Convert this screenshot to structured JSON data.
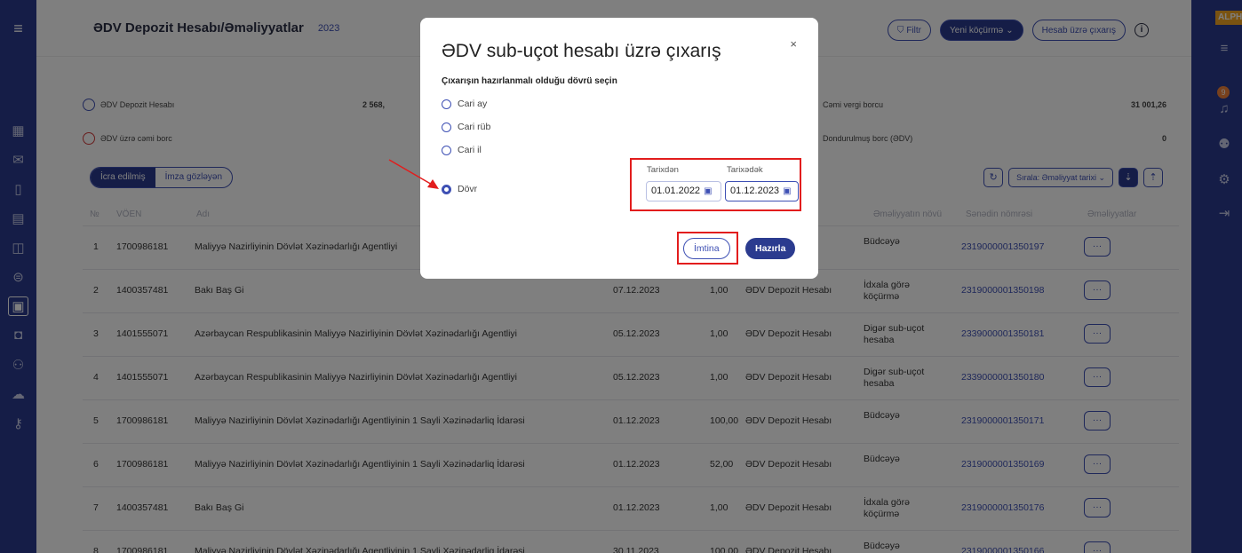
{
  "header": {
    "title": "ƏDV Depozit Hesabı/Əməliyyatlar",
    "year": "2023",
    "filter_label": "Filtr",
    "new_transfer_label": "Yeni köçürmə",
    "statement_label": "Hesab üzrə çıxarış",
    "info_symbol": "i"
  },
  "right_panel": {
    "alpha_label": "ALPH",
    "notification_count": "9"
  },
  "summary": {
    "left_row1_label": "ƏDV Depozit Hesabı",
    "left_row1_value": "2 568,",
    "left_row2_label": "ƏDV üzrə cəmi borc",
    "right_row1_label": "Cəmi vergi borcu",
    "right_row1_value": "31 001,26",
    "right_row2_label": "Dondurulmuş borc (ƏDV)",
    "right_row2_value": "0"
  },
  "tabs": {
    "executed": "İcra edilmiş",
    "awaiting_signature": "İmza gözləyən"
  },
  "sort": {
    "label": "Sırala: Əməliyyat tarixi"
  },
  "table": {
    "columns": {
      "no": "№",
      "voen": "VÖEN",
      "name": "Adı",
      "type": "Əməliyyatın növü",
      "doc": "Sənədin nömrəsi",
      "actions": "Əməliyyatlar"
    },
    "rows": [
      {
        "no": "1",
        "voen": "1700986181",
        "name": "Maliyyə Nazirliyinin Dövlət Xəzinədarlığı Agentliyi",
        "date": "",
        "amount": "",
        "account": "Hesabı",
        "type": "Büdcəyə",
        "doc": "2319000001350197"
      },
      {
        "no": "2",
        "voen": "1400357481",
        "name": "Bakı Baş Gi",
        "date": "07.12.2023",
        "amount": "1,00",
        "account": "ƏDV Depozit Hesabı",
        "type": "İdxala görə köçürmə",
        "doc": "2319000001350198"
      },
      {
        "no": "3",
        "voen": "1401555071",
        "name": "Azərbaycan Respublikasinin Maliyyə Nazirliyinin Dövlət Xəzinədarlığı Agentliyi",
        "date": "05.12.2023",
        "amount": "1,00",
        "account": "ƏDV Depozit Hesabı",
        "type": "Digər sub-uçot hesaba",
        "doc": "2339000001350181"
      },
      {
        "no": "4",
        "voen": "1401555071",
        "name": "Azərbaycan Respublikasinin Maliyyə Nazirliyinin Dövlət Xəzinədarlığı Agentliyi",
        "date": "05.12.2023",
        "amount": "1,00",
        "account": "ƏDV Depozit Hesabı",
        "type": "Digər sub-uçot hesaba",
        "doc": "2339000001350180"
      },
      {
        "no": "5",
        "voen": "1700986181",
        "name": "Maliyyə Nazirliyinin Dövlət Xəzinədarlığı Agentliyinin 1 Sayli Xəzinədarliq İdarəsi",
        "date": "01.12.2023",
        "amount": "100,00",
        "account": "ƏDV Depozit Hesabı",
        "type": "Büdcəyə",
        "doc": "2319000001350171"
      },
      {
        "no": "6",
        "voen": "1700986181",
        "name": "Maliyyə Nazirliyinin Dövlət Xəzinədarlığı Agentliyinin 1 Sayli Xəzinədarliq İdarəsi",
        "date": "01.12.2023",
        "amount": "52,00",
        "account": "ƏDV Depozit Hesabı",
        "type": "Büdcəyə",
        "doc": "2319000001350169"
      },
      {
        "no": "7",
        "voen": "1400357481",
        "name": "Bakı Baş Gi",
        "date": "01.12.2023",
        "amount": "1,00",
        "account": "ƏDV Depozit Hesabı",
        "type": "İdxala görə köçürmə",
        "doc": "2319000001350176"
      },
      {
        "no": "8",
        "voen": "1700986181",
        "name": "Maliyyə Nazirliyinin Dövlət Xəzinədarlığı Agentliyinin 1 Sayli Xəzinədarliq İdarəsi",
        "date": "30.11.2023",
        "amount": "100,00",
        "account": "ƏDV Depozit Hesabı",
        "type": "Büdcəyə",
        "doc": "2319000001350166"
      }
    ],
    "action_symbol": "···"
  },
  "modal": {
    "title": "ƏDV sub-uçot hesabı üzrə çıxarış",
    "close_symbol": "×",
    "period_prompt": "Çıxarışın hazırlanmalı olduğu dövrü seçin",
    "options": [
      "Cari ay",
      "Cari rüb",
      "Cari il",
      "Dövr"
    ],
    "selected_option": "Dövr",
    "from_label": "Tarixdən",
    "from_value": "01.01.2022",
    "to_label": "Tarixədək",
    "to_value": "01.12.2023",
    "cancel_label": "İmtina",
    "submit_label": "Hazırla"
  },
  "colors": {
    "primary": "#2b3b8f",
    "accent": "#3e50b4",
    "highlight_red": "#e21d1d",
    "alpha_orange": "#f5a623"
  }
}
